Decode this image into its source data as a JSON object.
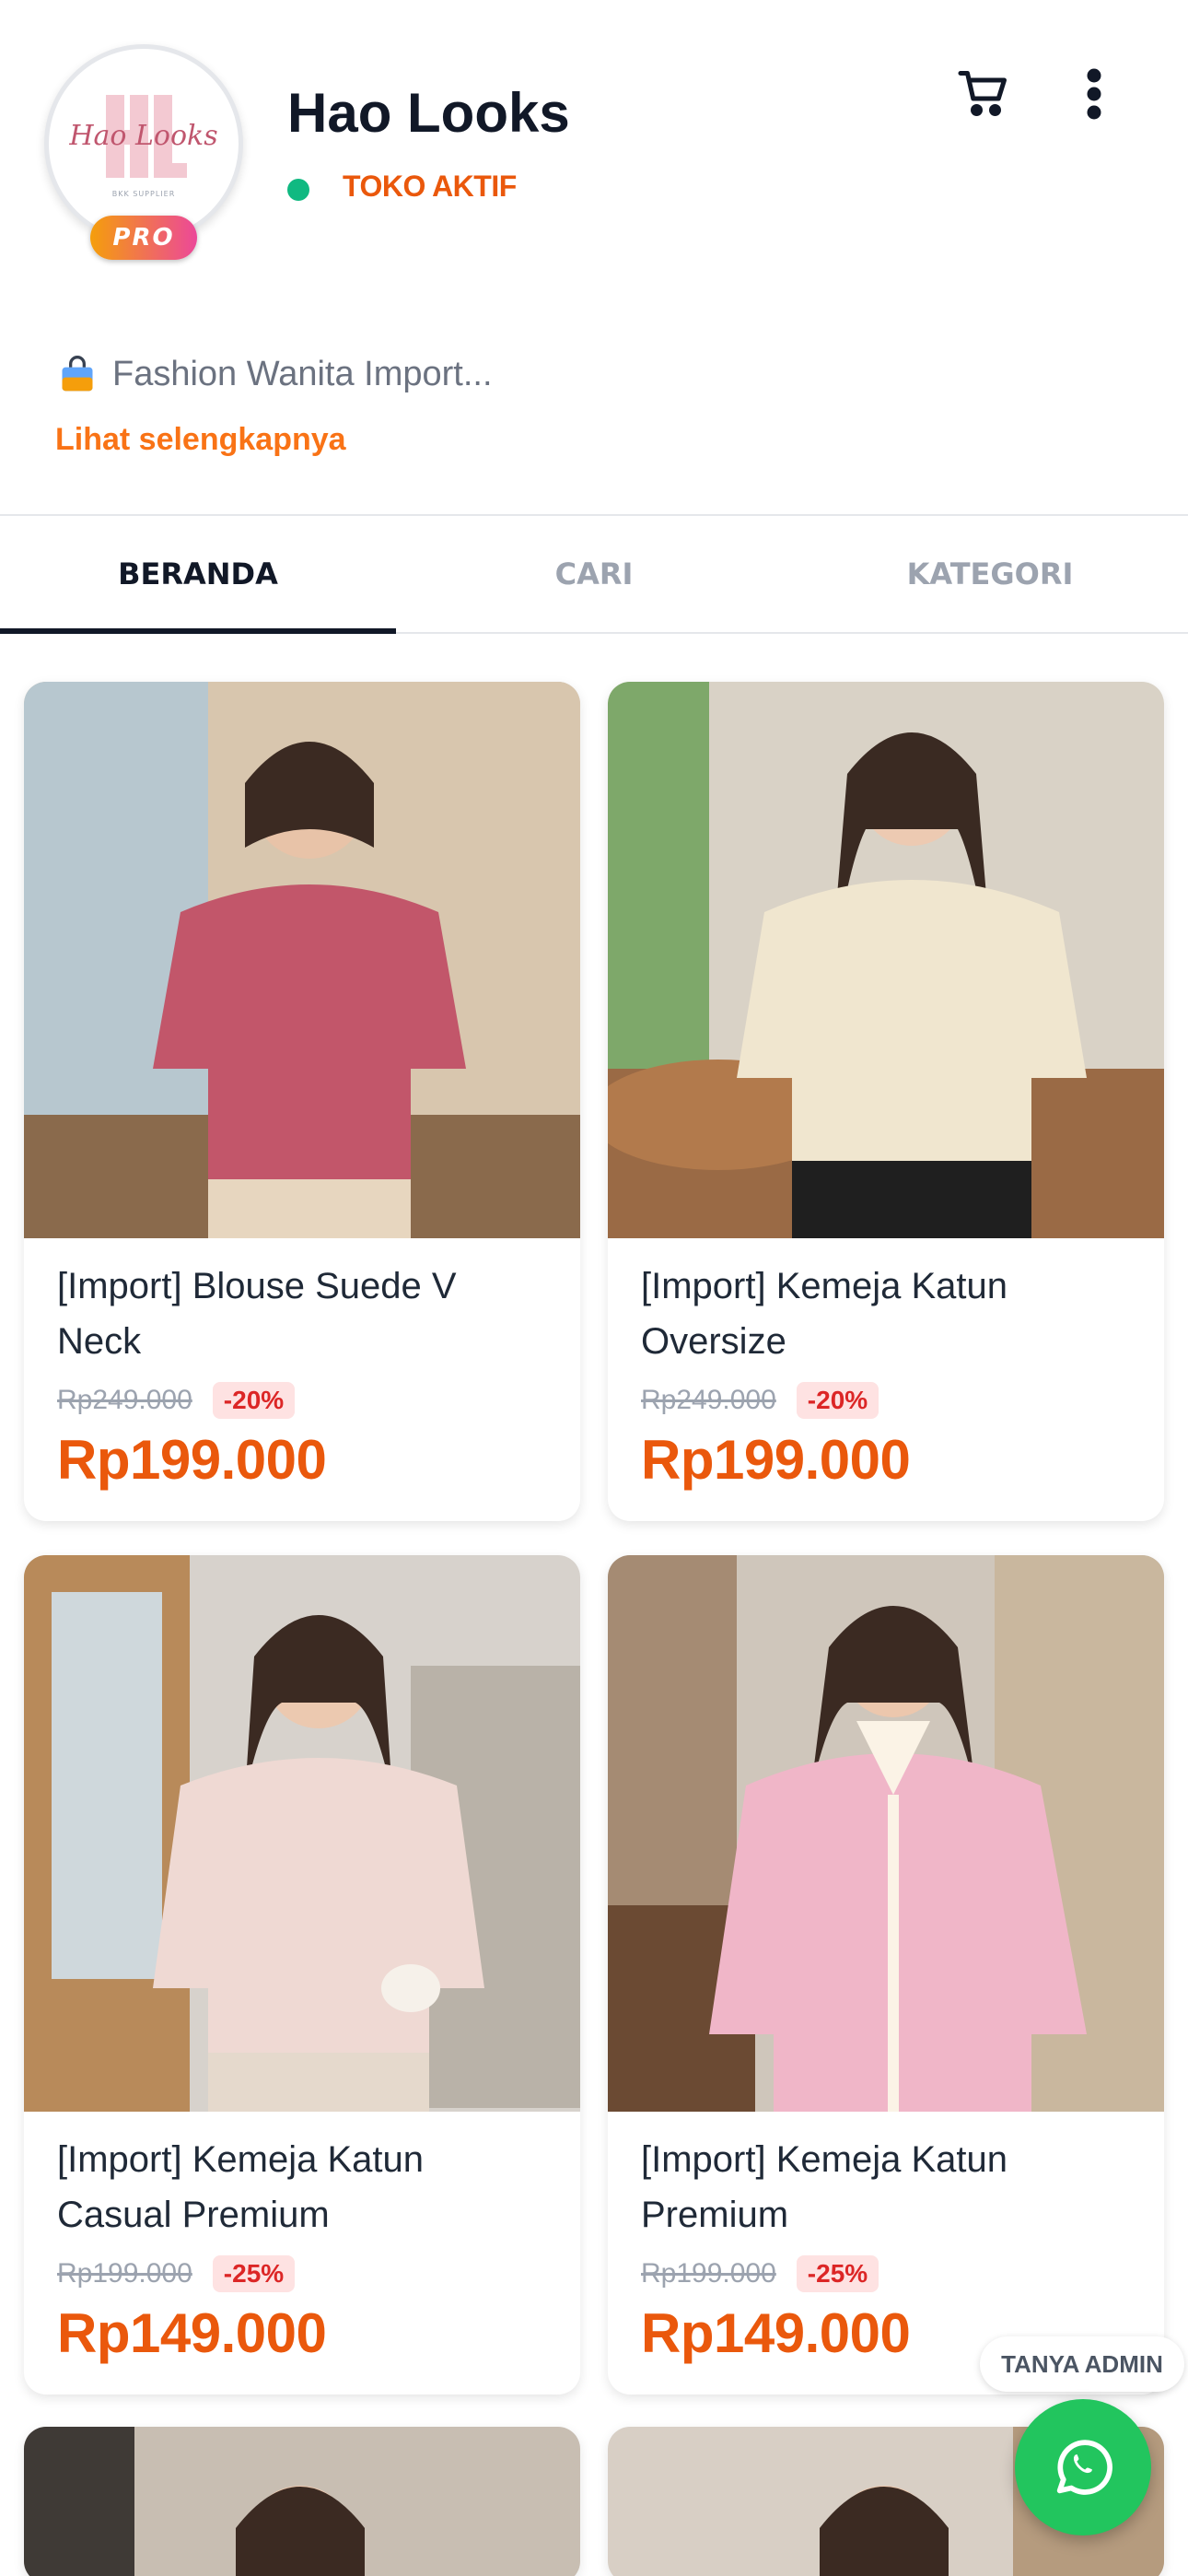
{
  "shop": {
    "name": "Hao Looks",
    "logo_text": "Hao Looks",
    "logo_sub": "BKK SUPPLIER",
    "badge": "PRO",
    "status": "TOKO AKTIF",
    "status_color": "#10b981",
    "description": "Fashion Wanita Import...",
    "see_more": "Lihat selengkapnya",
    "description_icon": "shopping-bag-icon"
  },
  "header_icons": [
    "cart-icon",
    "more-vertical-icon"
  ],
  "tabs": [
    {
      "label": "BERANDA",
      "active": true
    },
    {
      "label": "CARI",
      "active": false
    },
    {
      "label": "KATEGORI",
      "active": false
    }
  ],
  "products": [
    {
      "title": "[Import] Blouse Suede V Neck",
      "old_price": "Rp249.000",
      "discount": "-20%",
      "price": "Rp199.000",
      "color": "#c2566a"
    },
    {
      "title": "[Import] Kemeja Katun Oversize",
      "old_price": "Rp249.000",
      "discount": "-20%",
      "price": "Rp199.000",
      "color": "#f0e6cf"
    },
    {
      "title": "[Import] Kemeja Katun Casual Premium",
      "old_price": "Rp199.000",
      "discount": "-25%",
      "price": "Rp149.000",
      "color": "#efd9d3"
    },
    {
      "title": "[Import] Kemeja Katun Premium",
      "old_price": "Rp199.000",
      "discount": "-25%",
      "price": "Rp149.000",
      "color": "#f0b6c8"
    }
  ],
  "floating": {
    "ask_admin": "TANYA ADMIN",
    "whatsapp_icon": "whatsapp-icon"
  },
  "colors": {
    "accent": "#ea580c",
    "link": "#f97316",
    "discount_bg": "#fee2e2",
    "discount_text": "#dc2626",
    "whatsapp": "#22c55e"
  }
}
